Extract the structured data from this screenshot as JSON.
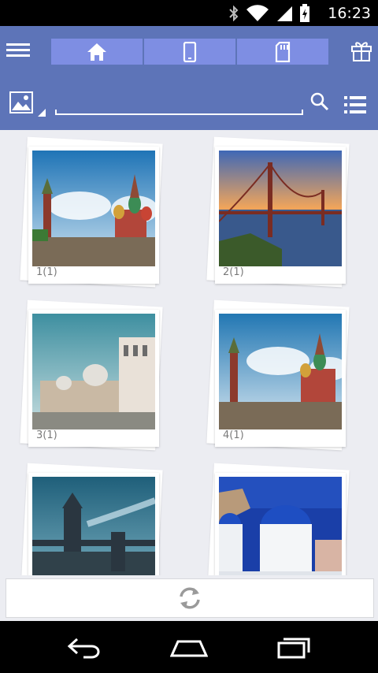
{
  "status": {
    "time": "16:23"
  },
  "toolbar": {
    "tabs": [
      {
        "name": "home",
        "icon": "home-icon"
      },
      {
        "name": "phone",
        "icon": "phone-icon"
      },
      {
        "name": "sdcard",
        "icon": "sd-card-icon"
      }
    ]
  },
  "search": {
    "placeholder": ""
  },
  "albums": [
    {
      "label": "1(1)"
    },
    {
      "label": "2(1)"
    },
    {
      "label": "3(1)"
    },
    {
      "label": "4(1)"
    },
    {
      "label": ""
    },
    {
      "label": ""
    }
  ],
  "colors": {
    "appbar": "#5d74b8",
    "tab": "#7e8ee3",
    "bg": "#ecedf2"
  }
}
